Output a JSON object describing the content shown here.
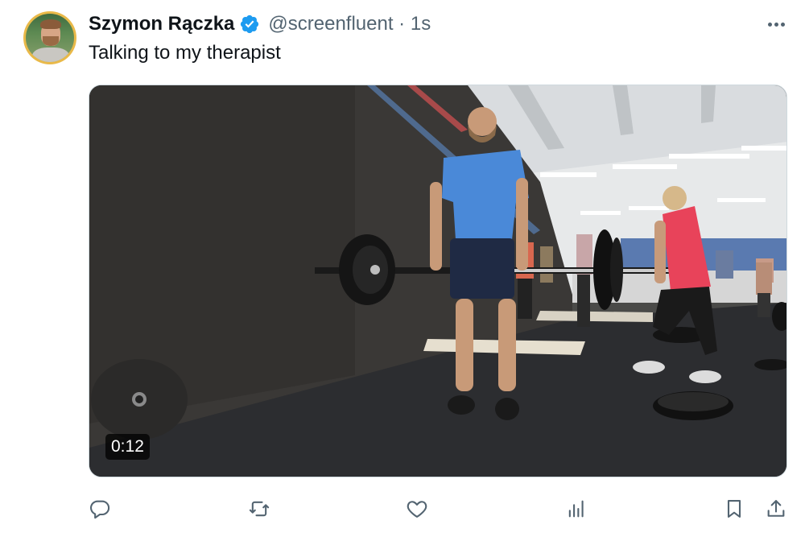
{
  "author": {
    "display_name": "Szymon Rączka",
    "handle_meta": "@screenfluent · 1s",
    "verified": true
  },
  "tweet": {
    "text": "Talking to my therapist"
  },
  "media": {
    "type": "video",
    "duration": "0:12"
  },
  "icons": {
    "more": "more-horizontal-icon",
    "reply": "reply-icon",
    "retweet": "retweet-icon",
    "like": "like-icon",
    "views": "views-icon",
    "bookmark": "bookmark-icon",
    "share": "share-icon"
  },
  "colors": {
    "verified_badge": "#1d9bf0",
    "action_icon": "#536471",
    "avatar_ring": "#e9b949"
  }
}
